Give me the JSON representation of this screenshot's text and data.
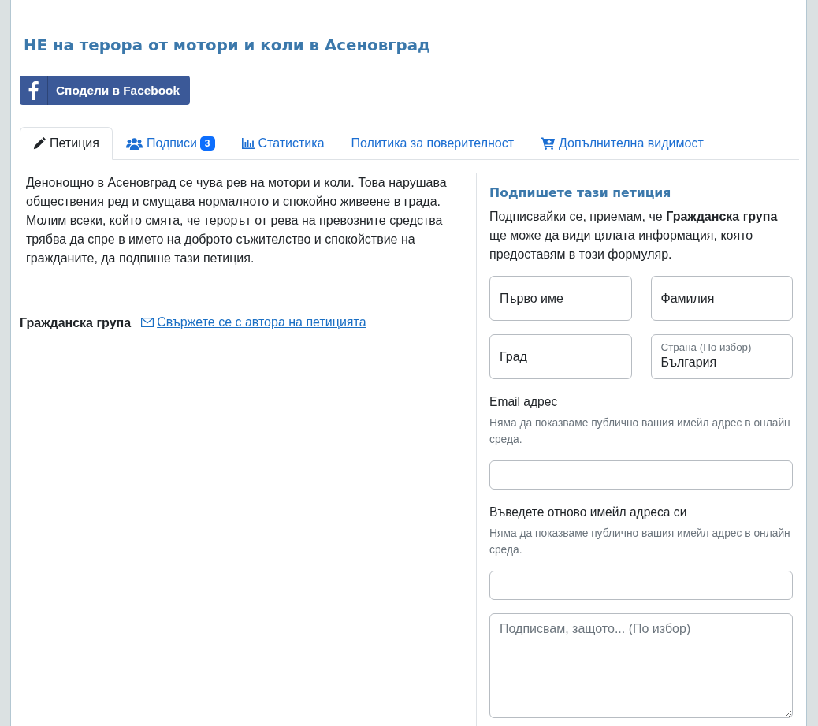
{
  "page": {
    "title": "НЕ на терора от мотори и коли в Асеновград",
    "share_button": {
      "label": "Сподели в Facebook"
    }
  },
  "tabs": [
    {
      "label": "Петиция",
      "selected": true
    },
    {
      "label": "Подписи",
      "badge": "3",
      "selected": false
    },
    {
      "label": "Статистика",
      "selected": false
    },
    {
      "label": "Политика за поверителност",
      "selected": false
    },
    {
      "label": "Допълнителна видимост",
      "selected": false
    }
  ],
  "petition": {
    "text": "Денонощно в Асеновград се чува рев на мотори и коли. Това нарушава обществения ред и смущава нормалното и спокойно живеене в града. Молим всеки, който смята, че терорът от рева на превозните средства трябва да спре в името на доброто съжителство и спокойствие на гражданите, да подпише тази петиция.",
    "author": "Гражданска група",
    "contact_link": "Свържете се с автора на петицията"
  },
  "sign_form": {
    "heading": "Подпишете тази петиция",
    "consent_text": "Подписвайки се, приемам, че **Гражданска група** ще може да види цялата информация, която предоставям в този формуляр.",
    "fields": [
      {
        "kind": "text",
        "placeholder": "Първо име"
      },
      {
        "kind": "text",
        "placeholder": "Фамилия"
      },
      {
        "kind": "text",
        "placeholder": "Град"
      },
      {
        "kind": "floating",
        "label": "Страна (По избор)",
        "value": "България"
      },
      {
        "kind": "labeled",
        "label": "Email адрес",
        "help": "Няма да показваме публично вашия имейл адрес в онлайн среда."
      },
      {
        "kind": "labeled",
        "label": "Въведете отново имейл адреса си",
        "help": "Няма да показваме публично вашия имейл адрес в онлайн среда."
      },
      {
        "kind": "textarea",
        "placeholder": "Подписвам, защото... (По избор)"
      }
    ]
  }
}
